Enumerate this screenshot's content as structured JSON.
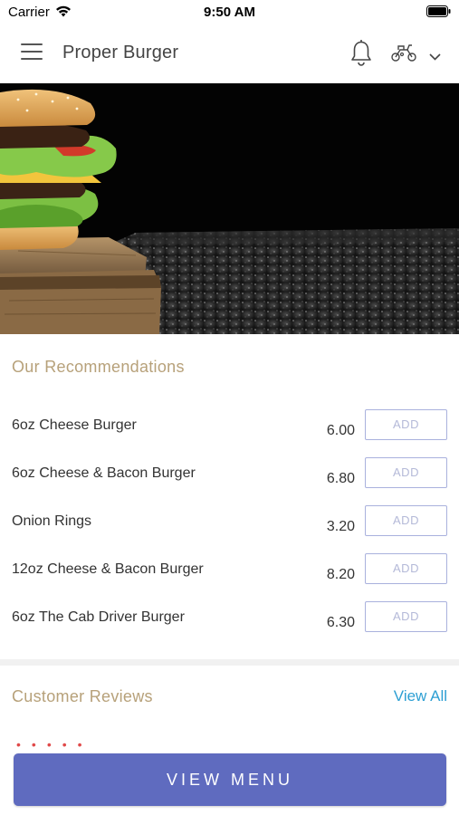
{
  "status_bar": {
    "carrier": "Carrier",
    "time": "9:50 AM"
  },
  "header": {
    "title": "Proper Burger",
    "icons": [
      "hamburger-menu-icon",
      "bell-icon",
      "scooter-icon",
      "chevron-down-icon"
    ]
  },
  "hero": {
    "image": "burger-on-wooden-board"
  },
  "recommendations": {
    "title": "Our Recommendations",
    "add_label": "ADD",
    "items": [
      {
        "name": "6oz Cheese Burger",
        "price": "6.00"
      },
      {
        "name": "6oz Cheese & Bacon Burger",
        "price": "6.80"
      },
      {
        "name": "Onion Rings",
        "price": "3.20"
      },
      {
        "name": "12oz Cheese & Bacon Burger",
        "price": "8.20"
      },
      {
        "name": "6oz The Cab Driver Burger",
        "price": "6.30"
      }
    ]
  },
  "reviews": {
    "title": "Customer Reviews",
    "view_all": "View All",
    "rating_stars": 5
  },
  "cta": {
    "label": "VIEW MENU"
  },
  "colors": {
    "accent": "#5f6bbf",
    "section_title": "#b7a17a",
    "link": "#2d9fd3",
    "add_border": "#a9b1dd",
    "stars": "#e04a4a"
  }
}
